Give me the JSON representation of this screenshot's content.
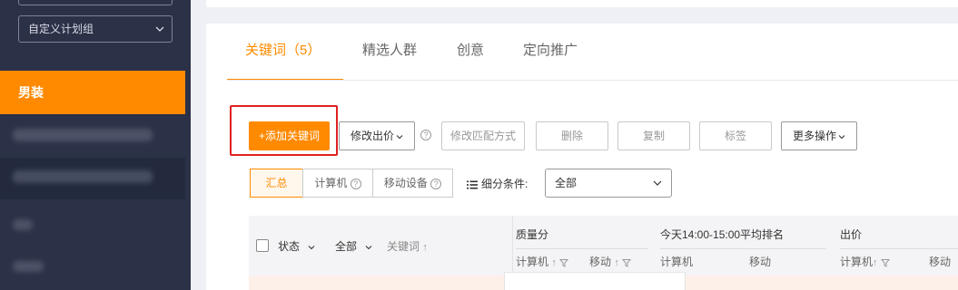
{
  "sidebar": {
    "group_select": "自定义计划组",
    "active_item": "男装"
  },
  "tabs": [
    {
      "label": "关键词（5）"
    },
    {
      "label": "精选人群"
    },
    {
      "label": "创意"
    },
    {
      "label": "定向推广"
    }
  ],
  "toolbar": {
    "add_keyword": "+添加关键词",
    "modify_bid": "修改出价",
    "modify_match": "修改匹配方式",
    "delete": "删除",
    "copy": "复制",
    "tag": "标签",
    "more_ops": "更多操作"
  },
  "device_tabs": [
    {
      "label": "汇总"
    },
    {
      "label": "计算机"
    },
    {
      "label": "移动设备"
    }
  ],
  "filter": {
    "label": "细分条件:",
    "value": "全部"
  },
  "table": {
    "status": "状态",
    "all": "全部",
    "keyword": "关键词",
    "quality_score": "质量分",
    "computer": "计算机",
    "mobile": "移动",
    "avg_rank": "今天14:00-15:00平均排名",
    "bid": "出价",
    "sort_up": "↑"
  },
  "colors": {
    "accent": "#ff8a00",
    "sidebar_bg": "#2b3147",
    "highlight_box": "#e02020"
  }
}
